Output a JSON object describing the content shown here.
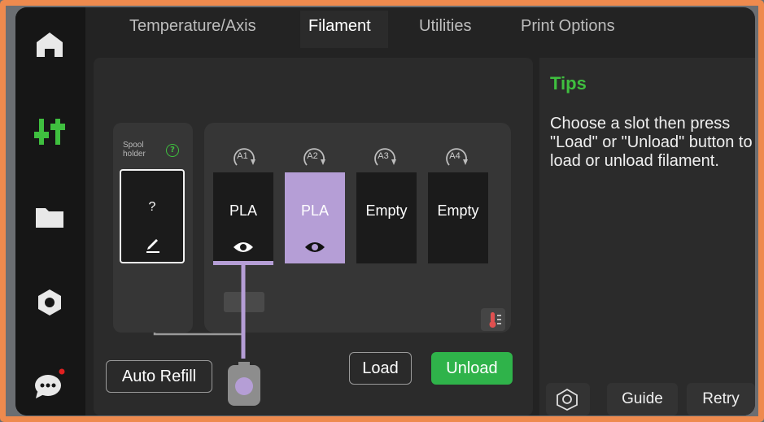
{
  "tabs": [
    {
      "label": "Temperature/Axis"
    },
    {
      "label": "Filament"
    },
    {
      "label": "Utilities"
    },
    {
      "label": "Print Options"
    }
  ],
  "active_tab": "Filament",
  "sidebar": {
    "items": [
      {
        "icon": "home-icon"
      },
      {
        "icon": "control-sliders-icon",
        "active": true
      },
      {
        "icon": "folder-icon"
      },
      {
        "icon": "hex-nut-settings-icon"
      },
      {
        "icon": "chat-bubble-icon",
        "notification": true
      }
    ]
  },
  "tips": {
    "title": "Tips",
    "text": "Choose a slot then press \"Load\" or \"Unload\" button to load or unload filament."
  },
  "spool_holder": {
    "label": "Spool holder",
    "help": "?",
    "value": "?"
  },
  "ams_slots": [
    {
      "tag": "A1",
      "name": "PLA",
      "color": "#1b1b1b",
      "visible_icon": true
    },
    {
      "tag": "A2",
      "name": "PLA",
      "color": "#b59ed6",
      "visible_icon": true,
      "selected": true
    },
    {
      "tag": "A3",
      "name": "Empty",
      "color": "#1b1b1b",
      "visible_icon": false
    },
    {
      "tag": "A4",
      "name": "Empty",
      "color": "#1b1b1b",
      "visible_icon": false
    }
  ],
  "buttons": {
    "auto_refill": "Auto Refill",
    "load": "Load",
    "unload": "Unload",
    "guide": "Guide",
    "retry": "Retry"
  },
  "colors": {
    "accent": "#2fb34a",
    "tips_title": "#3fbf3f",
    "selected_filament": "#b59ed6",
    "frame": "#ee8a4e"
  }
}
